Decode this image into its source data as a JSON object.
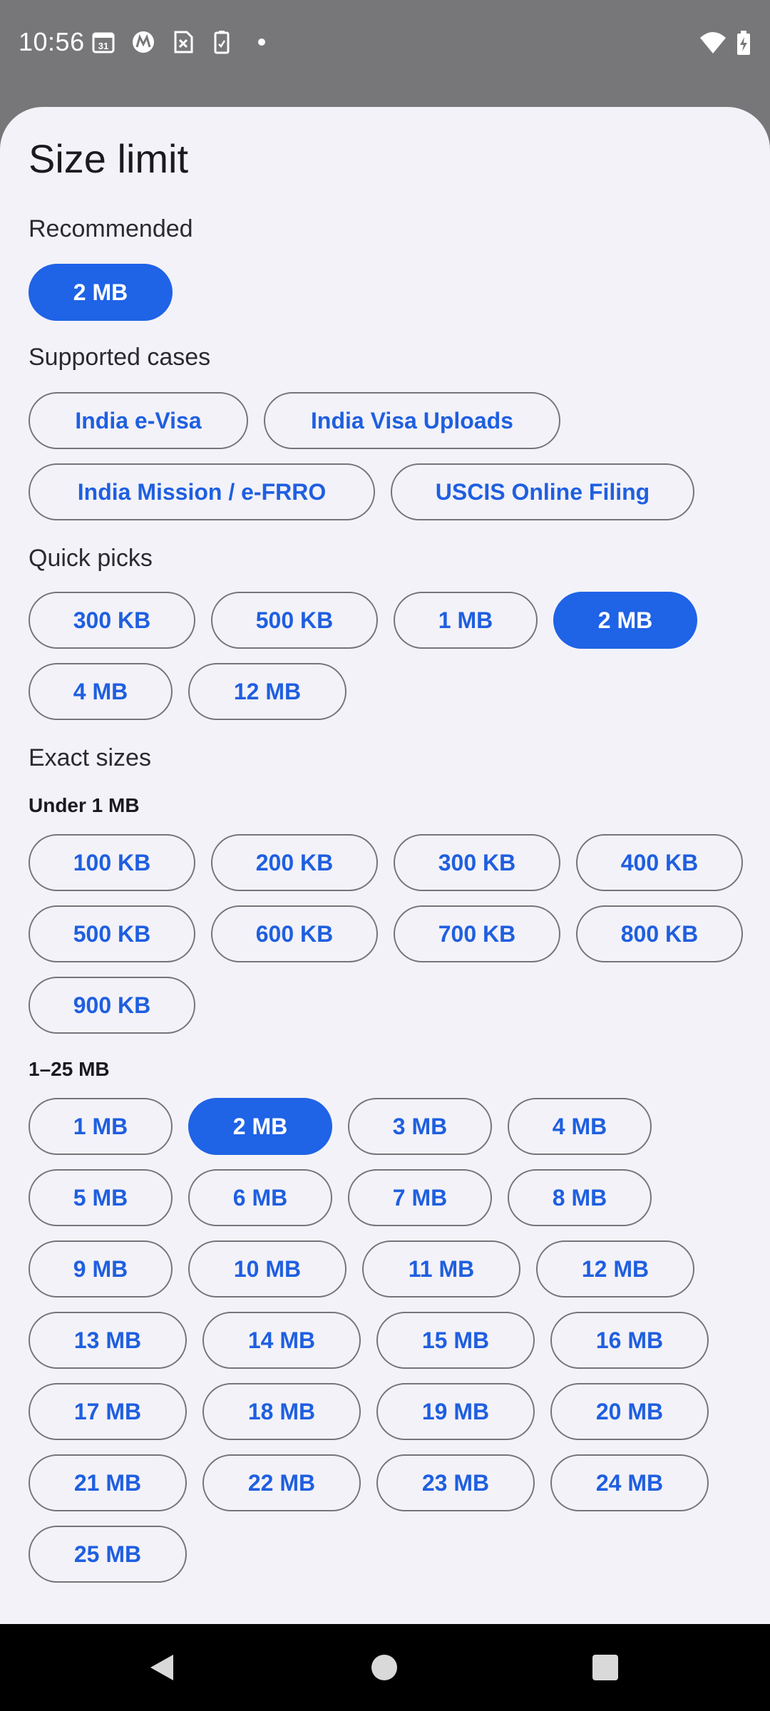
{
  "status_bar": {
    "time": "10:56",
    "icons": [
      "calendar-icon",
      "motorola-icon",
      "sim-off-icon",
      "battery-saver-icon",
      "dot-icon"
    ],
    "right_icons": [
      "wifi-icon",
      "battery-charging-icon"
    ],
    "calendar_day": "31"
  },
  "sheet": {
    "title": "Size limit",
    "recommended": {
      "label": "Recommended",
      "chip": "2 MB"
    },
    "supported": {
      "label": "Supported cases",
      "chips": [
        "India e-Visa",
        "India Visa Uploads",
        "India Mission / e-FRRO",
        "USCIS Online Filing"
      ]
    },
    "quick": {
      "label": "Quick picks",
      "chips": [
        "300 KB",
        "500 KB",
        "1 MB",
        "2 MB",
        "4 MB",
        "12 MB"
      ]
    },
    "exact": {
      "label": "Exact sizes",
      "under1_label": "Under 1 MB",
      "under1": [
        "100 KB",
        "200 KB",
        "300 KB",
        "400 KB",
        "500 KB",
        "600 KB",
        "700 KB",
        "800 KB",
        "900 KB"
      ],
      "mb_label": "1–25 MB",
      "mb": [
        "1 MB",
        "2 MB",
        "3 MB",
        "4 MB",
        "5 MB",
        "6 MB",
        "7 MB",
        "8 MB",
        "9 MB",
        "10 MB",
        "11 MB",
        "12 MB",
        "13 MB",
        "14 MB",
        "15 MB",
        "16 MB",
        "17 MB",
        "18 MB",
        "19 MB",
        "20 MB",
        "21 MB",
        "22 MB",
        "23 MB",
        "24 MB",
        "25 MB"
      ]
    }
  },
  "colors": {
    "accent": "#1f63e6",
    "chip_text": "#1f5fe0",
    "sheet_bg": "#f3f2f8",
    "scrim": "#777779"
  },
  "nav": [
    "back-icon",
    "home-icon",
    "recents-icon"
  ]
}
